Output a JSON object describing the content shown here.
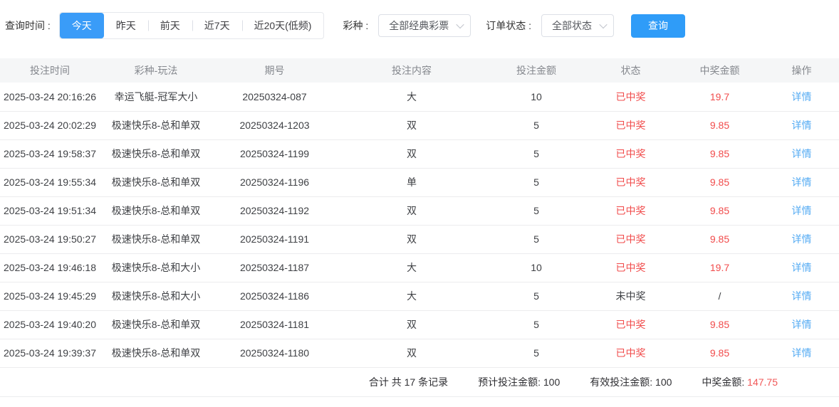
{
  "filters": {
    "time_label": "查询时间 :",
    "time_options": [
      {
        "key": "today",
        "label": "今天",
        "active": true
      },
      {
        "key": "yesterday",
        "label": "昨天",
        "active": false
      },
      {
        "key": "day-before",
        "label": "前天",
        "active": false
      },
      {
        "key": "last-7-days",
        "label": "近7天",
        "active": false
      },
      {
        "key": "last-20-days",
        "label": "近20天(低频)",
        "active": false
      }
    ],
    "lottery_label": "彩种 :",
    "lottery_value": "全部经典彩票",
    "status_label": "订单状态 :",
    "status_value": "全部状态",
    "search_button": "查询"
  },
  "table": {
    "columns": [
      "投注时间",
      "彩种-玩法",
      "期号",
      "投注内容",
      "投注金额",
      "状态",
      "中奖金额",
      "操作"
    ],
    "action_label": "详情",
    "rows": [
      {
        "time": "2025-03-24 20:16:26",
        "game": "幸运飞艇-冠军大小",
        "issue": "20250324-087",
        "content": "大",
        "amount": "10",
        "status": "已中奖",
        "prize": "19.7",
        "won": true
      },
      {
        "time": "2025-03-24 20:02:29",
        "game": "极速快乐8-总和单双",
        "issue": "20250324-1203",
        "content": "双",
        "amount": "5",
        "status": "已中奖",
        "prize": "9.85",
        "won": true
      },
      {
        "time": "2025-03-24 19:58:37",
        "game": "极速快乐8-总和单双",
        "issue": "20250324-1199",
        "content": "双",
        "amount": "5",
        "status": "已中奖",
        "prize": "9.85",
        "won": true
      },
      {
        "time": "2025-03-24 19:55:34",
        "game": "极速快乐8-总和单双",
        "issue": "20250324-1196",
        "content": "单",
        "amount": "5",
        "status": "已中奖",
        "prize": "9.85",
        "won": true
      },
      {
        "time": "2025-03-24 19:51:34",
        "game": "极速快乐8-总和单双",
        "issue": "20250324-1192",
        "content": "双",
        "amount": "5",
        "status": "已中奖",
        "prize": "9.85",
        "won": true
      },
      {
        "time": "2025-03-24 19:50:27",
        "game": "极速快乐8-总和单双",
        "issue": "20250324-1191",
        "content": "双",
        "amount": "5",
        "status": "已中奖",
        "prize": "9.85",
        "won": true
      },
      {
        "time": "2025-03-24 19:46:18",
        "game": "极速快乐8-总和大小",
        "issue": "20250324-1187",
        "content": "大",
        "amount": "10",
        "status": "已中奖",
        "prize": "19.7",
        "won": true
      },
      {
        "time": "2025-03-24 19:45:29",
        "game": "极速快乐8-总和大小",
        "issue": "20250324-1186",
        "content": "大",
        "amount": "5",
        "status": "未中奖",
        "prize": "/",
        "won": false
      },
      {
        "time": "2025-03-24 19:40:20",
        "game": "极速快乐8-总和单双",
        "issue": "20250324-1181",
        "content": "双",
        "amount": "5",
        "status": "已中奖",
        "prize": "9.85",
        "won": true
      },
      {
        "time": "2025-03-24 19:39:37",
        "game": "极速快乐8-总和单双",
        "issue": "20250324-1180",
        "content": "双",
        "amount": "5",
        "status": "已中奖",
        "prize": "9.85",
        "won": true
      }
    ]
  },
  "summary": {
    "total_records": "合计 共 17 条记录",
    "expected_label": "预计投注金额:",
    "expected_value": "100",
    "valid_label": "有效投注金额:",
    "valid_value": "100",
    "prize_label": "中奖金额:",
    "prize_value": "147.75"
  },
  "colors": {
    "accent_blue": "#2f9cf8",
    "link_blue": "#54abf3",
    "win_red": "#f14b4b",
    "header_bg": "#f5f6f7"
  }
}
